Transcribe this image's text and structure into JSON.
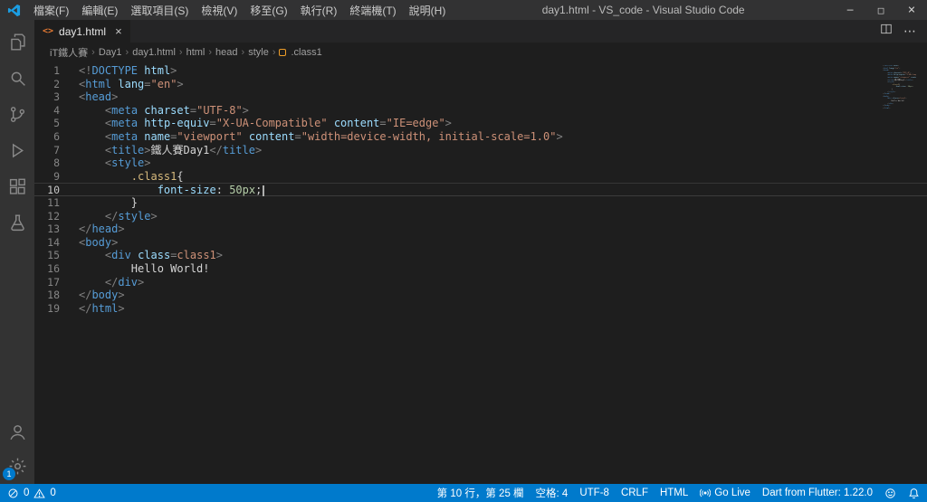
{
  "window": {
    "title": "day1.html - VS_code - Visual Studio Code",
    "menus": [
      "檔案(F)",
      "編輯(E)",
      "選取項目(S)",
      "檢視(V)",
      "移至(G)",
      "執行(R)",
      "終端機(T)",
      "說明(H)"
    ]
  },
  "icons": {
    "minimize": "─",
    "maximize": "□",
    "close": "×",
    "html_file": "<>",
    "tab_close": "×",
    "more": "⋯"
  },
  "activity_bar": {
    "items": [
      "explorer",
      "search",
      "source-control",
      "run-and-debug",
      "extensions",
      "testing"
    ],
    "bottom_items": [
      "account",
      "settings"
    ],
    "settings_badge": "1"
  },
  "tab_bar": {
    "tabs": [
      {
        "label": "day1.html"
      }
    ]
  },
  "breadcrumb": {
    "items": [
      "iT鐵人賽",
      "Day1",
      "day1.html",
      "html",
      "head",
      "style",
      ".class1"
    ],
    "separator": "›"
  },
  "editor": {
    "current_line": 10,
    "token_colors": {
      "k": "#569cd6",
      "a": "#9cdcfe",
      "s": "#ce9178",
      "p": "#808080",
      "t": "#d4d4d4",
      "sel": "#d7ba7d",
      "prop": "#9cdcfe",
      "num": "#b5cea8"
    },
    "lines": [
      [
        [
          "p",
          "<!"
        ],
        [
          "k",
          "DOCTYPE"
        ],
        [
          "t",
          " "
        ],
        [
          "a",
          "html"
        ],
        [
          "p",
          ">"
        ]
      ],
      [
        [
          "p",
          "<"
        ],
        [
          "k",
          "html"
        ],
        [
          "t",
          " "
        ],
        [
          "a",
          "lang"
        ],
        [
          "p",
          "="
        ],
        [
          "s",
          "\"en\""
        ],
        [
          "p",
          ">"
        ]
      ],
      [
        [
          "p",
          "<"
        ],
        [
          "k",
          "head"
        ],
        [
          "p",
          ">"
        ]
      ],
      [
        [
          "t",
          "    "
        ],
        [
          "p",
          "<"
        ],
        [
          "k",
          "meta"
        ],
        [
          "t",
          " "
        ],
        [
          "a",
          "charset"
        ],
        [
          "p",
          "="
        ],
        [
          "s",
          "\"UTF-8\""
        ],
        [
          "p",
          ">"
        ]
      ],
      [
        [
          "t",
          "    "
        ],
        [
          "p",
          "<"
        ],
        [
          "k",
          "meta"
        ],
        [
          "t",
          " "
        ],
        [
          "a",
          "http-equiv"
        ],
        [
          "p",
          "="
        ],
        [
          "s",
          "\"X-UA-Compatible\""
        ],
        [
          "t",
          " "
        ],
        [
          "a",
          "content"
        ],
        [
          "p",
          "="
        ],
        [
          "s",
          "\"IE=edge\""
        ],
        [
          "p",
          ">"
        ]
      ],
      [
        [
          "t",
          "    "
        ],
        [
          "p",
          "<"
        ],
        [
          "k",
          "meta"
        ],
        [
          "t",
          " "
        ],
        [
          "a",
          "name"
        ],
        [
          "p",
          "="
        ],
        [
          "s",
          "\"viewport\""
        ],
        [
          "t",
          " "
        ],
        [
          "a",
          "content"
        ],
        [
          "p",
          "="
        ],
        [
          "s",
          "\"width=device-width, initial-scale=1.0\""
        ],
        [
          "p",
          ">"
        ]
      ],
      [
        [
          "t",
          "    "
        ],
        [
          "p",
          "<"
        ],
        [
          "k",
          "title"
        ],
        [
          "p",
          ">"
        ],
        [
          "t",
          "鐵人賽Day1"
        ],
        [
          "p",
          "</"
        ],
        [
          "k",
          "title"
        ],
        [
          "p",
          ">"
        ]
      ],
      [
        [
          "t",
          "    "
        ],
        [
          "p",
          "<"
        ],
        [
          "k",
          "style"
        ],
        [
          "p",
          ">"
        ]
      ],
      [
        [
          "t",
          "        "
        ],
        [
          "sel",
          ".class1"
        ],
        [
          "t",
          "{"
        ]
      ],
      [
        [
          "t",
          "            "
        ],
        [
          "prop",
          "font-size"
        ],
        [
          "t",
          ": "
        ],
        [
          "num",
          "50px"
        ],
        [
          "t",
          ";"
        ]
      ],
      [
        [
          "t",
          "        }"
        ]
      ],
      [
        [
          "t",
          "    "
        ],
        [
          "p",
          "</"
        ],
        [
          "k",
          "style"
        ],
        [
          "p",
          ">"
        ]
      ],
      [
        [
          "p",
          "</"
        ],
        [
          "k",
          "head"
        ],
        [
          "p",
          ">"
        ]
      ],
      [
        [
          "p",
          "<"
        ],
        [
          "k",
          "body"
        ],
        [
          "p",
          ">"
        ]
      ],
      [
        [
          "t",
          "    "
        ],
        [
          "p",
          "<"
        ],
        [
          "k",
          "div"
        ],
        [
          "t",
          " "
        ],
        [
          "a",
          "class"
        ],
        [
          "p",
          "="
        ],
        [
          "s",
          "class1"
        ],
        [
          "p",
          ">"
        ]
      ],
      [
        [
          "t",
          "        Hello World!"
        ]
      ],
      [
        [
          "t",
          "    "
        ],
        [
          "p",
          "</"
        ],
        [
          "k",
          "div"
        ],
        [
          "p",
          ">"
        ]
      ],
      [
        [
          "p",
          "</"
        ],
        [
          "k",
          "body"
        ],
        [
          "p",
          ">"
        ]
      ],
      [
        [
          "p",
          "</"
        ],
        [
          "k",
          "html"
        ],
        [
          "p",
          ">"
        ]
      ]
    ]
  },
  "status_bar": {
    "errors": "0",
    "warnings": "0",
    "line_col": "第 10 行，第 25 欄",
    "indent": "空格: 4",
    "encoding": "UTF-8",
    "eol": "CRLF",
    "language": "HTML",
    "go_live": "Go Live",
    "dart_version": "Dart from Flutter: 1.22.0"
  },
  "colors": {
    "accent": "#007acc",
    "editor_bg": "#1e1e1e",
    "titlebar_bg": "#323233",
    "activitybar_bg": "#333333",
    "tabbar_bg": "#252526"
  }
}
